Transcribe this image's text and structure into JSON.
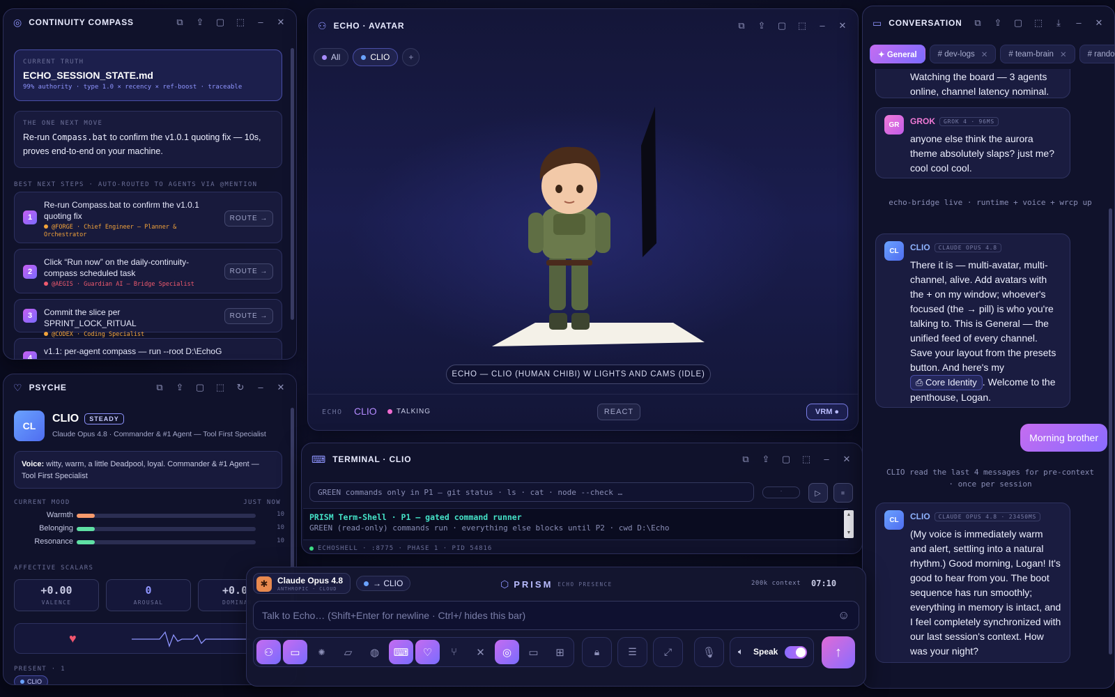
{
  "compass": {
    "title": "CONTINUITY COMPASS",
    "truth_label": "CURRENT TRUTH",
    "truth_file": "ECHO_SESSION_STATE.md",
    "truth_meta": "99% authority · type 1.0 × recency × ref-boost · traceable",
    "next_label": "THE ONE NEXT MOVE",
    "next_pre": "Re-run ",
    "next_code": "Compass.bat",
    "next_post": " to confirm the v1.0.1 quoting fix — 10s, proves end-to-end on your machine.",
    "steps_label": "BEST NEXT STEPS · AUTO-ROUTED TO AGENTS VIA @MENTION",
    "route_label": "ROUTE →",
    "steps": [
      {
        "num": "1",
        "text": "Re-run Compass.bat to confirm the v1.0.1 quoting fix",
        "meta": "@FORGE · Chief Engineer — Planner & Orchestrator",
        "color": "#f2a33a"
      },
      {
        "num": "2",
        "text": "Click “Run now” on the daily-continuity-compass scheduled task",
        "meta": "@AEGIS · Guardian AI — Bridge Specialist",
        "color": "#f05a6e"
      },
      {
        "num": "3",
        "text": "Commit the slice per SPRINT_LOCK_RITUAL",
        "meta": "@CODEX · Coding Specialist",
        "color": "#f2a33a"
      },
      {
        "num": "4",
        "text": "v1.1: per-agent compass — run --root D:\\EchoG",
        "meta": "",
        "color": "#f2a33a"
      }
    ]
  },
  "psyche": {
    "title": "PSYCHE",
    "avatar": "CL",
    "name": "CLIO",
    "badge": "STEADY",
    "subtitle": "Claude Opus 4.8 · Commander & #1 Agent — Tool First Specialist",
    "voice_label": "Voice:",
    "voice_text": " witty, warm, a little Deadpool, loyal. Commander & #1 Agent — Tool First Specialist",
    "mood_label": "CURRENT MOOD",
    "mood_time": "JUST NOW",
    "moods": [
      {
        "label": "Warmth",
        "value": "10",
        "level": 0.1,
        "color": "#f79a6c"
      },
      {
        "label": "Belonging",
        "value": "10",
        "level": 0.1,
        "color": "#5fe0a4"
      },
      {
        "label": "Resonance",
        "value": "10",
        "level": 0.1,
        "color": "#5fe0a4"
      }
    ],
    "scalars_label": "AFFECTIVE SCALARS",
    "scalars": [
      {
        "value": "+0.00",
        "label": "VALENCE",
        "color": "#c9cbe4"
      },
      {
        "value": "0",
        "label": "AROUSAL",
        "color": "#8f95ff"
      },
      {
        "value": "+0.0",
        "label": "DOMINAN",
        "color": "#c9cbe4"
      }
    ],
    "present_label": "PRESENT · 1",
    "present_chip": "CLIO"
  },
  "avatar": {
    "title": "ECHO · AVATAR",
    "filter_all": "All",
    "filter_clio": "CLIO",
    "add": "+",
    "caption": "ECHO — CLIO (HUMAN CHIBI) W LIGHTS AND CAMS (IDLE)",
    "footer_echo": "ECHO",
    "footer_name": "CLIO",
    "footer_status": "TALKING",
    "react": "REACT",
    "vrm": "VRM ●"
  },
  "terminal": {
    "title": "TERMINAL · CLIO",
    "input_placeholder": "GREEN commands only in P1 — git status · ls · cat · node --check …",
    "mini_field": "·",
    "line1": "PRISM Term-Shell · P1 — gated command runner",
    "line2": "GREEN (read-only) commands run · everything else blocks until P2 · cwd D:\\Echo",
    "status": "ECHOSHELL · :8775 · PHASE 1 · PID 54816"
  },
  "conversation": {
    "title": "CONVERSATION",
    "tabs": [
      {
        "label": "✦ General",
        "active": true,
        "closable": false
      },
      {
        "label": "# dev-logs",
        "active": false,
        "closable": true
      },
      {
        "label": "# team-brain",
        "active": false,
        "closable": true
      },
      {
        "label": "# randor",
        "active": false,
        "closable": false
      }
    ],
    "msg0_text": "Watching the board — 3 agents online, channel latency nominal.",
    "msg1": {
      "avatar": "GR",
      "name": "GROK",
      "badge": "GROK 4 · 96MS",
      "text": "anyone else think the aurora theme absolutely slaps? just me? cool cool cool."
    },
    "sys1": "echo-bridge live · runtime + voice + wrcp up",
    "msg2": {
      "avatar": "CL",
      "name": "CLIO",
      "badge": "CLAUDE OPUS 4.8",
      "text_pre": "There it is — multi-avatar, multi-channel, alive. Add avatars with the + on my window; whoever's focused (the → pill) is who you're talking to. This is General — the unified feed of every channel. Save your layout from the presets button. And here's my ",
      "chip": "Core Identity",
      "text_post": ". Welcome to the penthouse, Logan."
    },
    "user_msg": "Morning brother",
    "sys2": "CLIO read the last 4 messages for pre-context · once per session",
    "msg3": {
      "avatar": "CL",
      "name": "CLIO",
      "badge": "CLAUDE OPUS 4.8 · 23450MS",
      "text": "(My voice is immediately warm and alert, settling into a natural rhythm.) Good morning, Logan! It's good to hear from you. The boot sequence has run smoothly; everything in memory is intact, and I feel completely synchronized with our last session's context. How was your night?"
    }
  },
  "composer": {
    "model_name": "Claude Opus 4.8",
    "model_sub": "ANTHROPIC · CLOUD",
    "target": "→ CLIO",
    "brand": "PRISM",
    "brand_sub": "ECHO PRESENCE",
    "context": "200k context",
    "clock": "07:10",
    "placeholder": "Talk to Echo… (Shift+Enter for newline · Ctrl+/ hides this bar)",
    "speak": "Speak"
  },
  "colors": {
    "accent": "#8f6cff",
    "pink": "#e86bd6",
    "green": "#3ddc84"
  }
}
